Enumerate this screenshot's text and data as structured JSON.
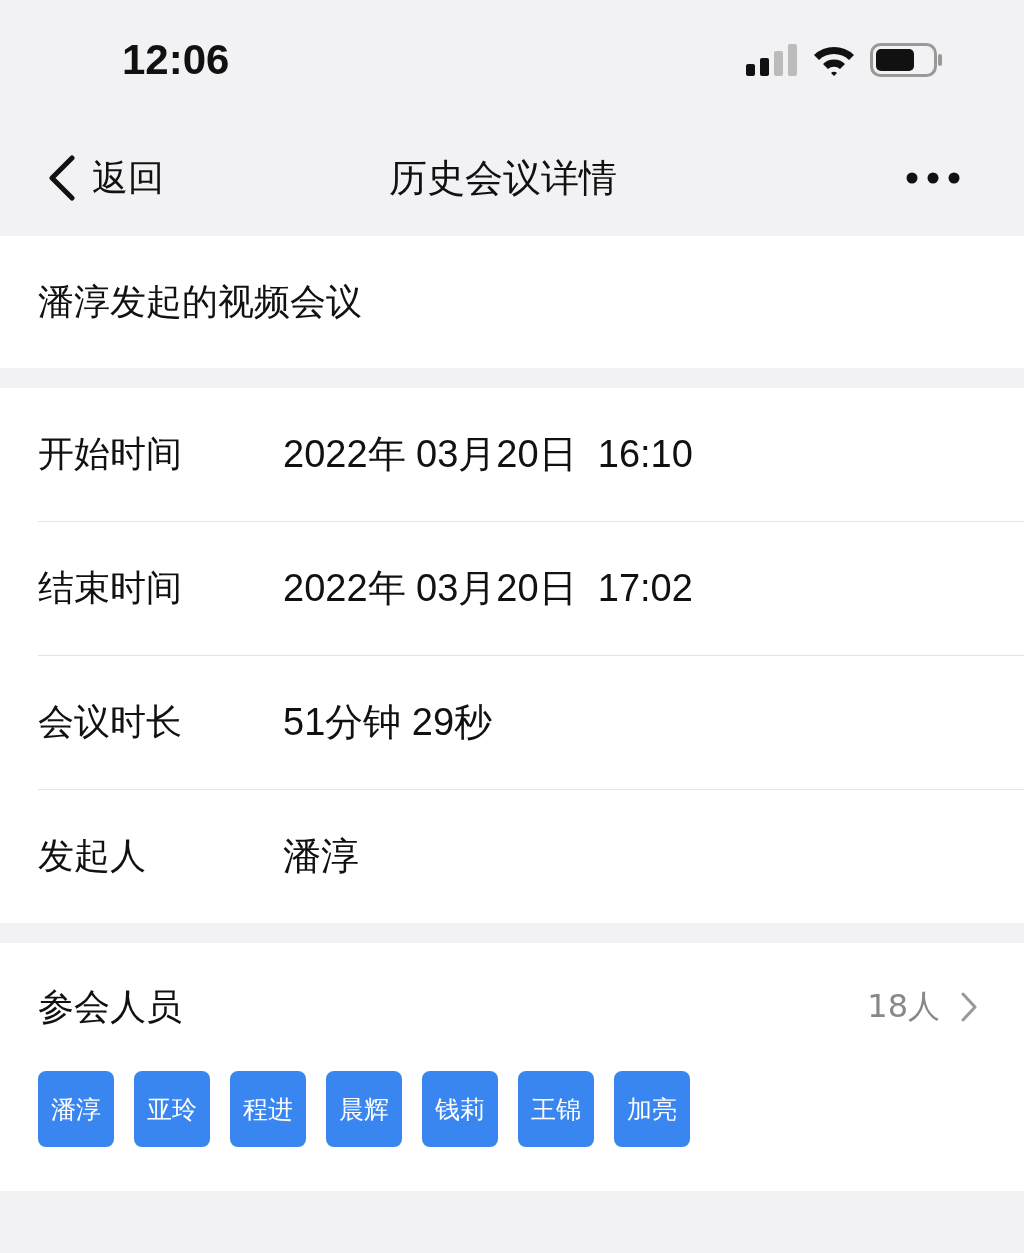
{
  "status_bar": {
    "time": "12:06"
  },
  "nav": {
    "back_label": "返回",
    "title": "历史会议详情"
  },
  "meeting_title": "潘淳发起的视频会议",
  "details": [
    {
      "label": "开始时间",
      "value": "2022年 03月20日  16:10"
    },
    {
      "label": "结束时间",
      "value": "2022年 03月20日  17:02"
    },
    {
      "label": "会议时长",
      "value": "51分钟 29秒"
    },
    {
      "label": "发起人",
      "value": "潘淳"
    }
  ],
  "participants": {
    "label": "参会人员",
    "count": "18人",
    "members": [
      "潘淳",
      "亚玲",
      "程进",
      "晨辉",
      "钱莉",
      "王锦",
      "加亮"
    ]
  }
}
